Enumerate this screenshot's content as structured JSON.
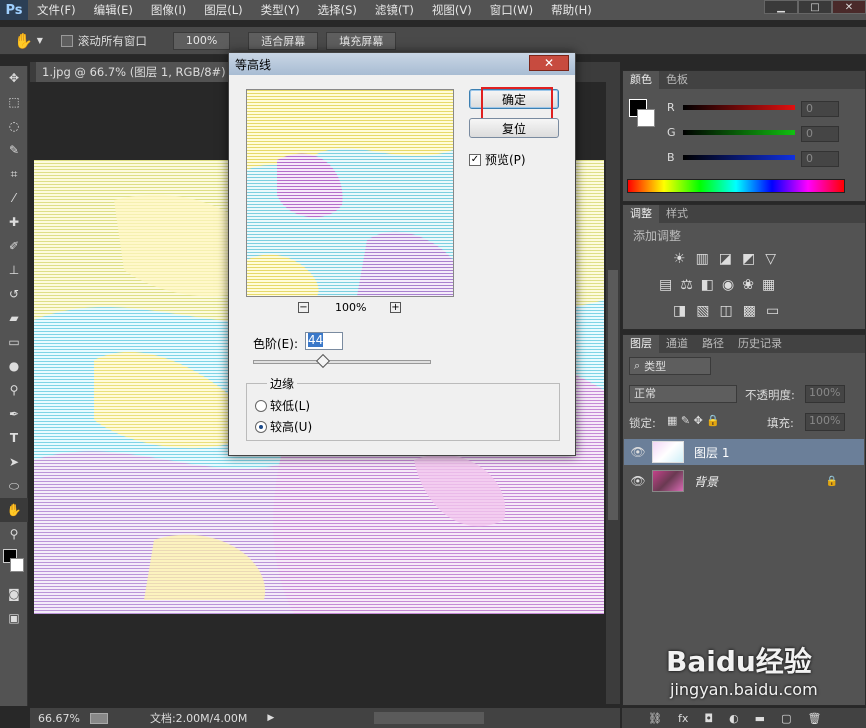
{
  "app": {
    "logo": "Ps"
  },
  "menu": [
    "文件(F)",
    "编辑(E)",
    "图像(I)",
    "图层(L)",
    "类型(Y)",
    "选择(S)",
    "滤镜(T)",
    "视图(V)",
    "窗口(W)",
    "帮助(H)"
  ],
  "options": {
    "scroll_all_label": "滚动所有窗口",
    "zoom_100": "100%",
    "fit_screen": "适合屏幕",
    "fill_screen": "填充屏幕"
  },
  "document": {
    "tab_title": "1.jpg @ 66.7% (图层 1, RGB/8#) *",
    "zoom": "66.67%",
    "doc_info": "文档:2.00M/4.00M"
  },
  "dialog": {
    "title": "等高线",
    "ok": "确定",
    "reset": "复位",
    "preview_label": "预览(P)",
    "preview_checked": true,
    "preview_zoom": "100%",
    "levels_label": "色阶(E):",
    "levels_value": "44",
    "edge_group": "边缘",
    "edge_low": "较低(L)",
    "edge_high": "较高(U)",
    "edge_selected": "high"
  },
  "color_panel": {
    "tabs": [
      "颜色",
      "色板"
    ],
    "channels": [
      {
        "name": "R",
        "value": "0",
        "color": "#d01010"
      },
      {
        "name": "G",
        "value": "0",
        "color": "#10b010"
      },
      {
        "name": "B",
        "value": "0",
        "color": "#1020d0"
      }
    ]
  },
  "adjust_panel": {
    "tabs": [
      "调整",
      "样式"
    ],
    "heading": "添加调整"
  },
  "layers_panel": {
    "tabs": [
      "图层",
      "通道",
      "路径",
      "历史记录"
    ],
    "filter_kind": "类型",
    "blend_mode": "正常",
    "opacity_label": "不透明度:",
    "opacity_value": "100%",
    "lock_label": "锁定:",
    "fill_label": "填充:",
    "fill_value": "100%",
    "layers": [
      {
        "name": "图层 1",
        "selected": true,
        "locked": false
      },
      {
        "name": "背景",
        "selected": false,
        "locked": true
      }
    ]
  },
  "watermark": {
    "brand": "Baidu经验",
    "url": "jingyan.baidu.com"
  },
  "colors": {
    "highlight_box": "#e02020",
    "selected_layer": "#6b7f99"
  }
}
